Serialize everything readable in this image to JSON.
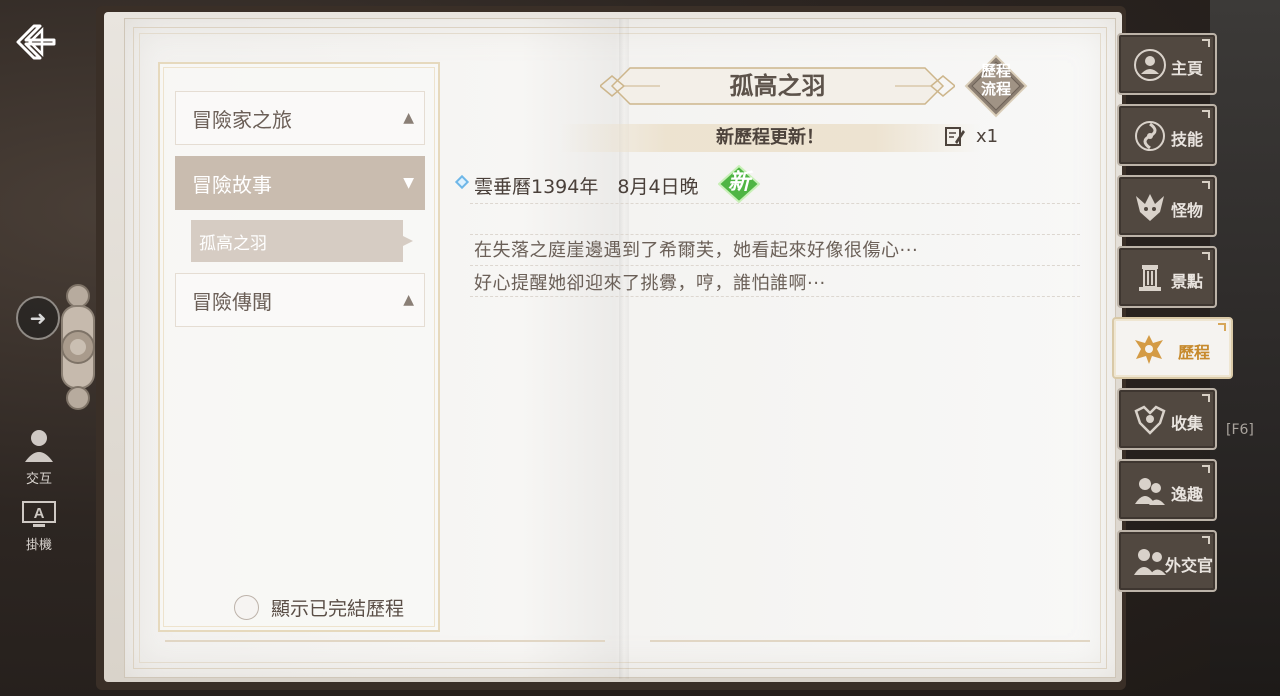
{
  "book": {
    "title": "孤高之羽",
    "flow_badge": [
      "歷程",
      "流程"
    ],
    "update_banner": "新歷程更新！",
    "update_count": "x1"
  },
  "left_nav": {
    "categories": [
      {
        "label": "冒險家之旅",
        "state": "collapsed"
      },
      {
        "label": "冒險故事",
        "state": "expanded"
      },
      {
        "label": "冒險傳聞",
        "state": "collapsed"
      }
    ],
    "sub_items": [
      {
        "label": "孤高之羽",
        "selected": true
      }
    ],
    "show_completed_label": "顯示已完結歷程"
  },
  "entry": {
    "date": "雲垂曆1394年　8月4日晚",
    "new_badge": "新",
    "lines": [
      "在失落之庭崖邊遇到了希爾芙，她看起來好像很傷心···",
      "好心提醒她卻迎來了挑釁，哼，誰怕誰啊···"
    ]
  },
  "right_tabs": [
    {
      "label": "主頁",
      "icon": "person-icon",
      "active": false
    },
    {
      "label": "技能",
      "icon": "swirl-icon",
      "active": false
    },
    {
      "label": "怪物",
      "icon": "monster-icon",
      "active": false
    },
    {
      "label": "景點",
      "icon": "landmark-icon",
      "active": false
    },
    {
      "label": "歷程",
      "icon": "crest-icon",
      "active": true
    },
    {
      "label": "收集",
      "icon": "emblem-icon",
      "active": false
    },
    {
      "label": "逸趣",
      "icon": "people-icon",
      "active": false
    },
    {
      "label": "外交官",
      "icon": "diplomat-icon",
      "active": false
    }
  ],
  "left_hud": {
    "interact_label": "交互",
    "auto_label": "掛機"
  },
  "right_hud": {
    "hotkey": "[F6]"
  },
  "colors": {
    "accent_gold": "#c78a2d",
    "tab_bg": "#514840",
    "active_category_bg": "#c9bcaf",
    "new_badge_green": "#4fb544"
  }
}
